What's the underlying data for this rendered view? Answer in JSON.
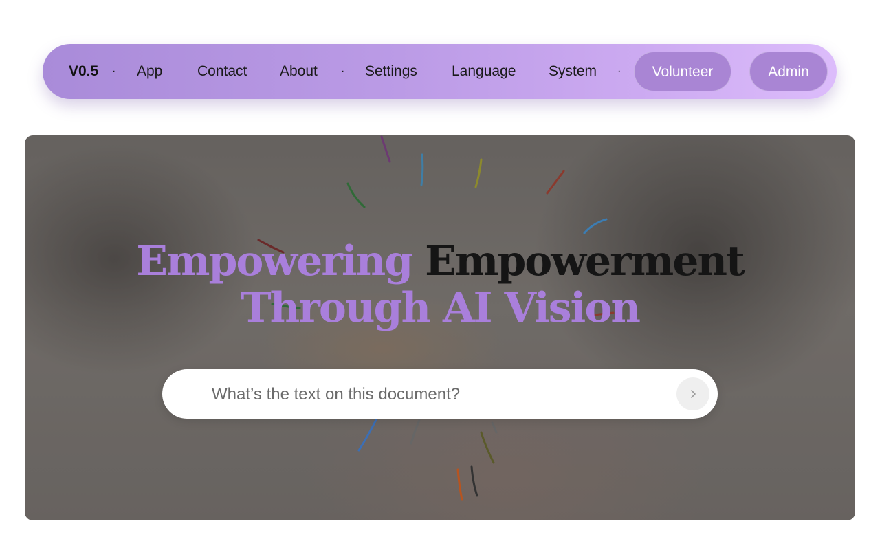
{
  "nav": {
    "brand": "V0.5",
    "separator": "·",
    "items": [
      "App",
      "Contact",
      "About",
      "Settings",
      "Language",
      "System"
    ],
    "volunteer": "Volunteer",
    "admin": "Admin"
  },
  "hero": {
    "headline_accent": "Empowering",
    "headline_dark": "Empowerment",
    "headline_line2": "Through AI Vision"
  },
  "search": {
    "placeholder": "What’s the text on this document?",
    "value": "",
    "submit_icon": "chevron-right-icon"
  },
  "colors": {
    "accent": "#a97fdb",
    "nav_gradient_start": "#a98bd9",
    "nav_gradient_end": "#dcbcfb",
    "pill": "#a985d4"
  }
}
